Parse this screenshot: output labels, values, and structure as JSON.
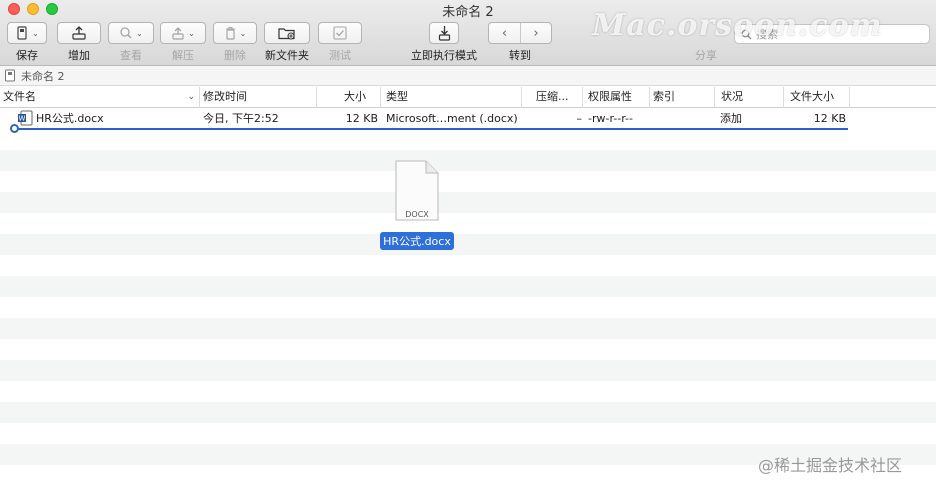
{
  "window": {
    "title": "未命名 2"
  },
  "toolbar": {
    "save": "保存",
    "add": "增加",
    "view": "查看",
    "extract": "解压",
    "delete": "删除",
    "new_folder": "新文件夹",
    "test": "测试",
    "execute_now": "立即执行模式",
    "goto": "转到",
    "share": "分享",
    "search_placeholder": "搜索"
  },
  "pathbar": {
    "name": "未命名 2"
  },
  "columns": [
    "文件名",
    "修改时间",
    "大小",
    "类型",
    "压缩...",
    "权限属性",
    "索引",
    "状况",
    "文件大小"
  ],
  "rows": [
    {
      "name": "HR公式.docx",
      "modified": "今日, 下午2:52",
      "size": "12 KB",
      "type": "Microsoft…ment (.docx)",
      "compressed": "–",
      "permissions": "-rw-r--r--",
      "index": "",
      "status": "添加",
      "file_size": "12 KB"
    }
  ],
  "drag_ghost": {
    "ext": "DOCX",
    "name": "HR公式.docx"
  },
  "watermarks": {
    "top": "Mac.orsoon.com",
    "bottom": "@稀土掘金技术社区"
  },
  "colors": {
    "selection": "#2f6fdc",
    "drop_indicator": "#2a62c9"
  }
}
